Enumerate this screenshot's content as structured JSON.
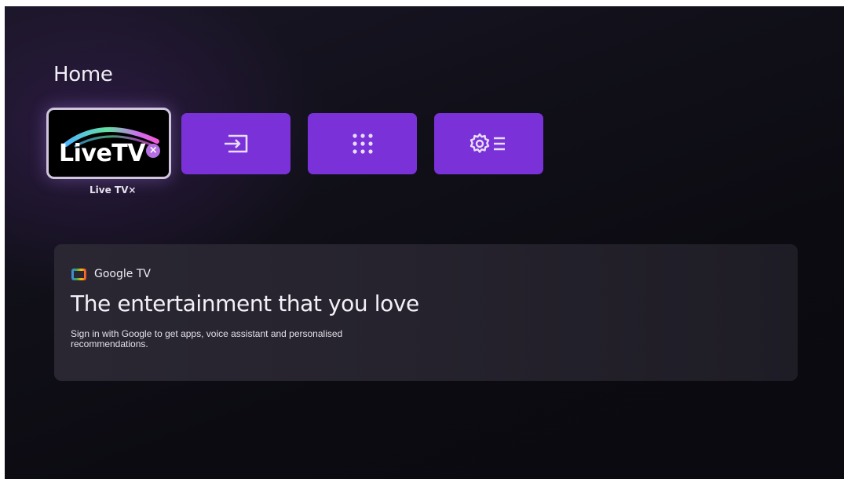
{
  "header": {
    "title": "Home"
  },
  "apps_row": {
    "featured": {
      "logo_text": "LiveTV",
      "logo_badge": "×",
      "caption": "Live TV×",
      "icon": "live-tv-logo"
    },
    "tiles": [
      {
        "icon": "input-source-icon"
      },
      {
        "icon": "apps-grid-icon"
      },
      {
        "icon": "settings-icon"
      }
    ]
  },
  "google_tv_card": {
    "brand": "Google TV",
    "heading": "The entertainment that you love",
    "body": "Sign in with Google to get apps, voice assistant and personalised recommendations."
  },
  "colors": {
    "tile_purple": "#7a31d8",
    "background": "#0f0d15",
    "card": "#27242f"
  }
}
